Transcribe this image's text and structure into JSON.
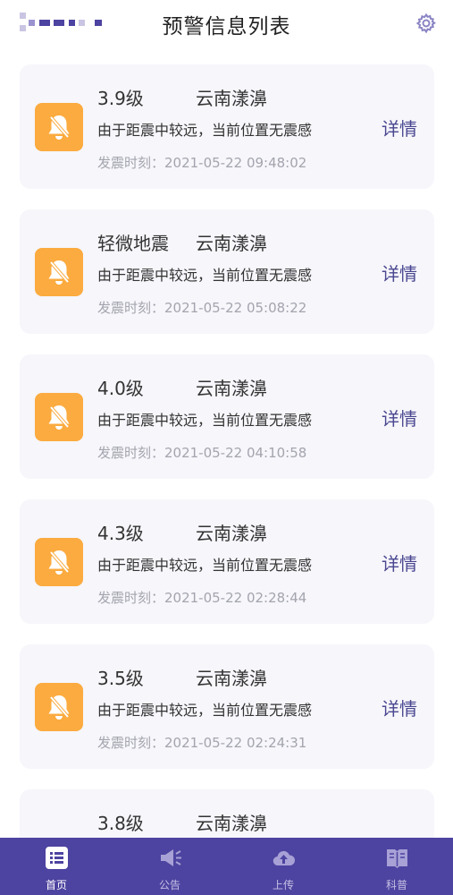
{
  "header": {
    "title": "预警信息列表"
  },
  "alerts": [
    {
      "magnitude": "3.9级",
      "location": "云南漾濞",
      "desc": "由于距震中较远，当前位置无震感",
      "time": "发震时刻：2021-05-22 09:48:02",
      "detail": "详情"
    },
    {
      "magnitude": "轻微地震",
      "location": "云南漾濞",
      "desc": "由于距震中较远，当前位置无震感",
      "time": "发震时刻：2021-05-22 05:08:22",
      "detail": "详情"
    },
    {
      "magnitude": "4.0级",
      "location": "云南漾濞",
      "desc": "由于距震中较远，当前位置无震感",
      "time": "发震时刻：2021-05-22 04:10:58",
      "detail": "详情"
    },
    {
      "magnitude": "4.3级",
      "location": "云南漾濞",
      "desc": "由于距震中较远，当前位置无震感",
      "time": "发震时刻：2021-05-22 02:28:44",
      "detail": "详情"
    },
    {
      "magnitude": "3.5级",
      "location": "云南漾濞",
      "desc": "由于距震中较远，当前位置无震感",
      "time": "发震时刻：2021-05-22 02:24:31",
      "detail": "详情"
    },
    {
      "magnitude": "3.8级",
      "location": "云南漾濞"
    }
  ],
  "tabs": [
    {
      "label": "首页",
      "icon": "list-icon",
      "active": true
    },
    {
      "label": "公告",
      "icon": "megaphone-icon",
      "active": false
    },
    {
      "label": "上传",
      "icon": "cloud-upload-icon",
      "active": false
    },
    {
      "label": "科普",
      "icon": "book-icon",
      "active": false
    }
  ],
  "colors": {
    "brand": "#4d43a0",
    "alert_icon_bg": "#fbab3f",
    "detail_text": "#4a4790",
    "card_bg": "#f6f6fb"
  }
}
